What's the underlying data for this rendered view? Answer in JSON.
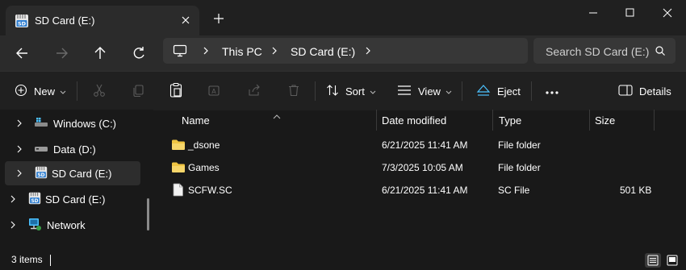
{
  "window": {
    "tab_title": "SD Card (E:)"
  },
  "address": {
    "crumbs": [
      "This PC",
      "SD Card (E:)"
    ],
    "search_placeholder": "Search SD Card (E:)"
  },
  "toolbar": {
    "new_label": "New",
    "sort_label": "Sort",
    "view_label": "View",
    "eject_label": "Eject",
    "details_label": "Details"
  },
  "nav": {
    "items": [
      {
        "label": "Windows (C:)",
        "icon": "windows-drive-icon"
      },
      {
        "label": "Data (D:)",
        "icon": "drive-icon"
      },
      {
        "label": "SD Card (E:)",
        "icon": "sd-card-icon",
        "selected": true
      },
      {
        "label": "SD Card (E:)",
        "icon": "sd-card-icon"
      },
      {
        "label": "Network",
        "icon": "network-icon"
      }
    ]
  },
  "columns": [
    "Name",
    "Date modified",
    "Type",
    "Size"
  ],
  "files": [
    {
      "name": "_dsone",
      "date": "6/21/2025 11:41 AM",
      "type": "File folder",
      "size": "",
      "icon": "folder-icon"
    },
    {
      "name": "Games",
      "date": "7/3/2025 10:05 AM",
      "type": "File folder",
      "size": "",
      "icon": "folder-icon"
    },
    {
      "name": "SCFW.SC",
      "date": "6/21/2025 11:41 AM",
      "type": "SC File",
      "size": "501 KB",
      "icon": "file-icon"
    }
  ],
  "status": {
    "item_count": "3 items"
  },
  "colors": {
    "accent": "#4cc2ff",
    "folder": "#f0c543",
    "background": "#191919",
    "chrome": "#2b2b2b"
  }
}
